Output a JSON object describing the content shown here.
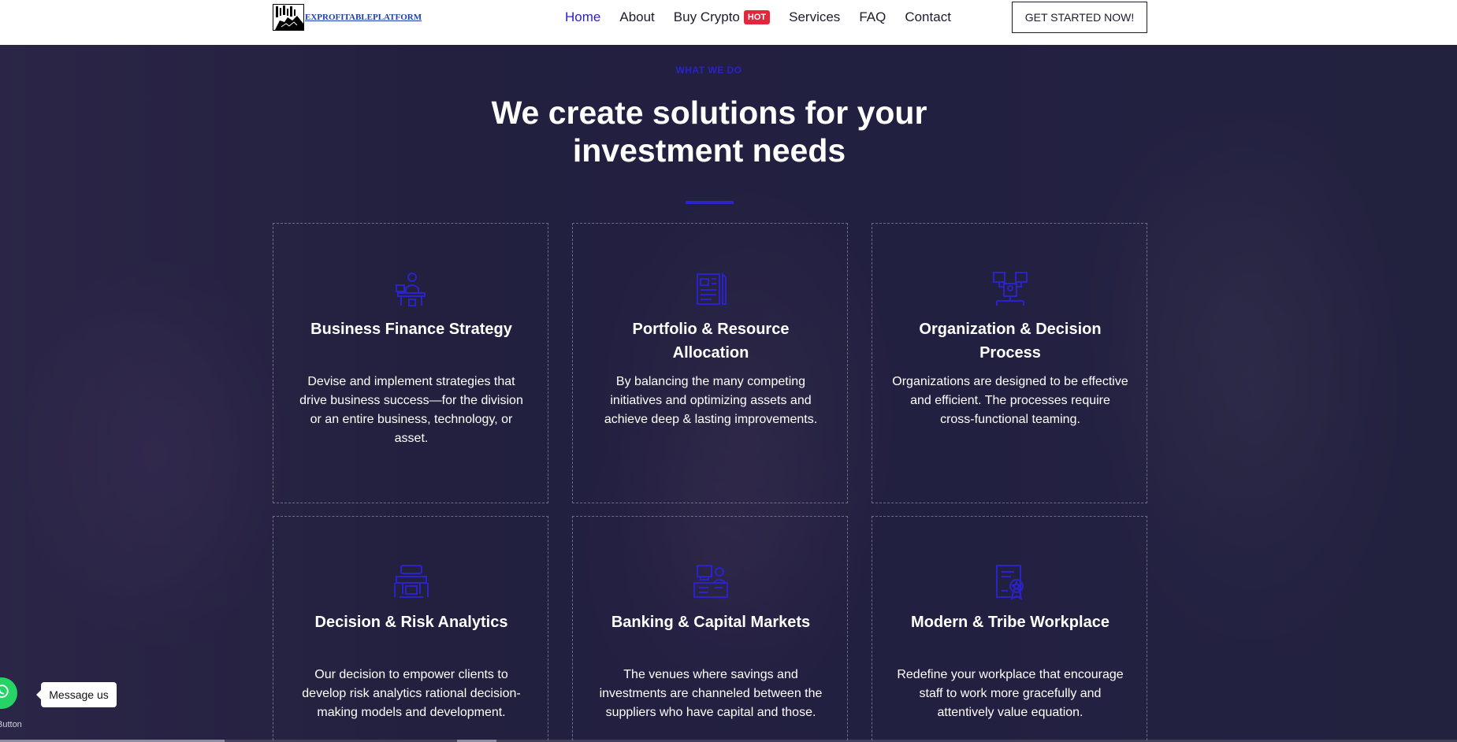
{
  "header": {
    "logo_text": "EXPROFITABLEPLATFORM",
    "nav": [
      {
        "label": "Home"
      },
      {
        "label": "About"
      },
      {
        "label": "Buy Crypto",
        "badge": "HOT"
      },
      {
        "label": "Services"
      },
      {
        "label": "FAQ"
      },
      {
        "label": "Contact"
      }
    ],
    "cta_label": "GET STARTED NOW!"
  },
  "section": {
    "kicker": "WHAT WE DO",
    "title": "We create solutions for your investment needs"
  },
  "cards": [
    {
      "icon": "finance-strategy-icon",
      "title": "Business Finance Strategy",
      "text": "Devise and implement strategies that drive business success—for the division or an entire business, technology, or asset."
    },
    {
      "icon": "portfolio-documents-icon",
      "title": "Portfolio & Resource Allocation",
      "text": "By balancing the many competing initiatives and optimizing assets and achieve deep & lasting improvements."
    },
    {
      "icon": "organization-chart-icon",
      "title": "Organization & Decision Process",
      "text": "Organizations are designed to be effective and efficient. The processes require cross-functional teaming."
    },
    {
      "icon": "meeting-table-icon",
      "title": "Decision & Risk Analytics",
      "text": "Our decision to empower clients to develop risk analytics rational decision-making models and development."
    },
    {
      "icon": "banking-desk-icon",
      "title": "Banking & Capital Markets",
      "text": "The venues where savings and investments are channeled between the suppliers who have capital and those."
    },
    {
      "icon": "certificate-award-icon",
      "title": "Modern & Tribe Workplace",
      "text": "Redefine your workplace that encourage staff to work more gracefully and attentively value equation."
    }
  ],
  "widget": {
    "tooltip": "Message us",
    "caption": "Button"
  },
  "colors": {
    "accent": "#2b22c8",
    "hot_badge": "#e3263b",
    "whatsapp": "#25d366"
  }
}
